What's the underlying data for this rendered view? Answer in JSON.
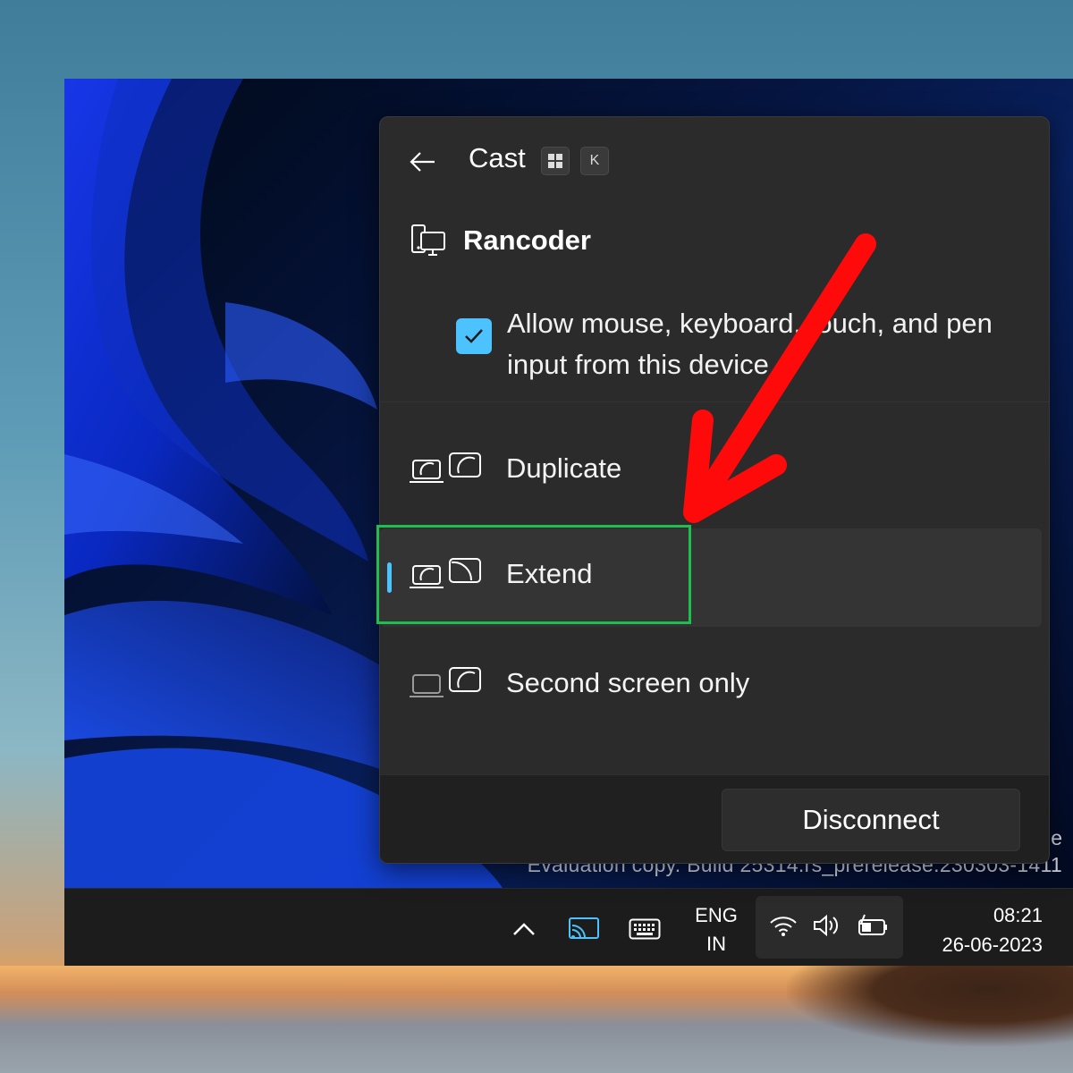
{
  "panel": {
    "title": "Cast",
    "shortcut_keys": [
      "⊞",
      "K"
    ],
    "device_name": "Rancoder",
    "allow_input": {
      "checked": true,
      "label": "Allow mouse, keyboard, touch, and pen input from this device"
    },
    "modes": [
      {
        "label": "Duplicate",
        "selected": false,
        "icon": "duplicate-display-icon"
      },
      {
        "label": "Extend",
        "selected": true,
        "icon": "extend-display-icon"
      },
      {
        "label": "Second screen only",
        "selected": false,
        "icon": "second-screen-only-icon"
      }
    ],
    "disconnect_label": "Disconnect"
  },
  "watermark": {
    "line1": "ge",
    "line2": "Evaluation copy. Build 25314.rs_prerelease.230303-1411"
  },
  "taskbar": {
    "language": {
      "line1": "ENG",
      "line2": "IN"
    },
    "time": "08:21",
    "date": "26-06-2023",
    "icons": [
      "chevron-up-icon",
      "cast-icon",
      "touch-keyboard-icon",
      "wifi-icon",
      "volume-icon",
      "battery-icon"
    ]
  },
  "colors": {
    "accent": "#4cc2ff",
    "highlight_box": "#1fbf4f",
    "annotation_arrow": "#ff0a0a",
    "panel_bg": "#2b2b2b"
  }
}
